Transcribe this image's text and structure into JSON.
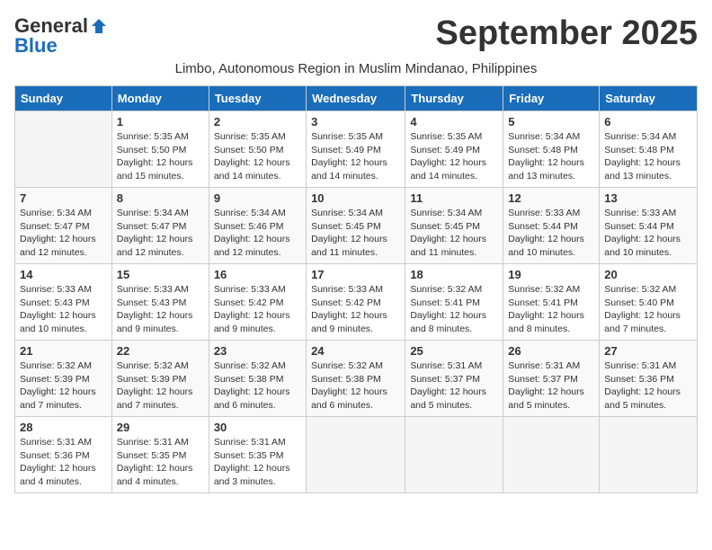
{
  "header": {
    "logo_general": "General",
    "logo_blue": "Blue",
    "month_title": "September 2025",
    "subtitle": "Limbo, Autonomous Region in Muslim Mindanao, Philippines"
  },
  "days_of_week": [
    "Sunday",
    "Monday",
    "Tuesday",
    "Wednesday",
    "Thursday",
    "Friday",
    "Saturday"
  ],
  "weeks": [
    [
      {
        "day": "",
        "info": ""
      },
      {
        "day": "1",
        "info": "Sunrise: 5:35 AM\nSunset: 5:50 PM\nDaylight: 12 hours\nand 15 minutes."
      },
      {
        "day": "2",
        "info": "Sunrise: 5:35 AM\nSunset: 5:50 PM\nDaylight: 12 hours\nand 14 minutes."
      },
      {
        "day": "3",
        "info": "Sunrise: 5:35 AM\nSunset: 5:49 PM\nDaylight: 12 hours\nand 14 minutes."
      },
      {
        "day": "4",
        "info": "Sunrise: 5:35 AM\nSunset: 5:49 PM\nDaylight: 12 hours\nand 14 minutes."
      },
      {
        "day": "5",
        "info": "Sunrise: 5:34 AM\nSunset: 5:48 PM\nDaylight: 12 hours\nand 13 minutes."
      },
      {
        "day": "6",
        "info": "Sunrise: 5:34 AM\nSunset: 5:48 PM\nDaylight: 12 hours\nand 13 minutes."
      }
    ],
    [
      {
        "day": "7",
        "info": "Sunrise: 5:34 AM\nSunset: 5:47 PM\nDaylight: 12 hours\nand 12 minutes."
      },
      {
        "day": "8",
        "info": "Sunrise: 5:34 AM\nSunset: 5:47 PM\nDaylight: 12 hours\nand 12 minutes."
      },
      {
        "day": "9",
        "info": "Sunrise: 5:34 AM\nSunset: 5:46 PM\nDaylight: 12 hours\nand 12 minutes."
      },
      {
        "day": "10",
        "info": "Sunrise: 5:34 AM\nSunset: 5:45 PM\nDaylight: 12 hours\nand 11 minutes."
      },
      {
        "day": "11",
        "info": "Sunrise: 5:34 AM\nSunset: 5:45 PM\nDaylight: 12 hours\nand 11 minutes."
      },
      {
        "day": "12",
        "info": "Sunrise: 5:33 AM\nSunset: 5:44 PM\nDaylight: 12 hours\nand 10 minutes."
      },
      {
        "day": "13",
        "info": "Sunrise: 5:33 AM\nSunset: 5:44 PM\nDaylight: 12 hours\nand 10 minutes."
      }
    ],
    [
      {
        "day": "14",
        "info": "Sunrise: 5:33 AM\nSunset: 5:43 PM\nDaylight: 12 hours\nand 10 minutes."
      },
      {
        "day": "15",
        "info": "Sunrise: 5:33 AM\nSunset: 5:43 PM\nDaylight: 12 hours\nand 9 minutes."
      },
      {
        "day": "16",
        "info": "Sunrise: 5:33 AM\nSunset: 5:42 PM\nDaylight: 12 hours\nand 9 minutes."
      },
      {
        "day": "17",
        "info": "Sunrise: 5:33 AM\nSunset: 5:42 PM\nDaylight: 12 hours\nand 9 minutes."
      },
      {
        "day": "18",
        "info": "Sunrise: 5:32 AM\nSunset: 5:41 PM\nDaylight: 12 hours\nand 8 minutes."
      },
      {
        "day": "19",
        "info": "Sunrise: 5:32 AM\nSunset: 5:41 PM\nDaylight: 12 hours\nand 8 minutes."
      },
      {
        "day": "20",
        "info": "Sunrise: 5:32 AM\nSunset: 5:40 PM\nDaylight: 12 hours\nand 7 minutes."
      }
    ],
    [
      {
        "day": "21",
        "info": "Sunrise: 5:32 AM\nSunset: 5:39 PM\nDaylight: 12 hours\nand 7 minutes."
      },
      {
        "day": "22",
        "info": "Sunrise: 5:32 AM\nSunset: 5:39 PM\nDaylight: 12 hours\nand 7 minutes."
      },
      {
        "day": "23",
        "info": "Sunrise: 5:32 AM\nSunset: 5:38 PM\nDaylight: 12 hours\nand 6 minutes."
      },
      {
        "day": "24",
        "info": "Sunrise: 5:32 AM\nSunset: 5:38 PM\nDaylight: 12 hours\nand 6 minutes."
      },
      {
        "day": "25",
        "info": "Sunrise: 5:31 AM\nSunset: 5:37 PM\nDaylight: 12 hours\nand 5 minutes."
      },
      {
        "day": "26",
        "info": "Sunrise: 5:31 AM\nSunset: 5:37 PM\nDaylight: 12 hours\nand 5 minutes."
      },
      {
        "day": "27",
        "info": "Sunrise: 5:31 AM\nSunset: 5:36 PM\nDaylight: 12 hours\nand 5 minutes."
      }
    ],
    [
      {
        "day": "28",
        "info": "Sunrise: 5:31 AM\nSunset: 5:36 PM\nDaylight: 12 hours\nand 4 minutes."
      },
      {
        "day": "29",
        "info": "Sunrise: 5:31 AM\nSunset: 5:35 PM\nDaylight: 12 hours\nand 4 minutes."
      },
      {
        "day": "30",
        "info": "Sunrise: 5:31 AM\nSunset: 5:35 PM\nDaylight: 12 hours\nand 3 minutes."
      },
      {
        "day": "",
        "info": ""
      },
      {
        "day": "",
        "info": ""
      },
      {
        "day": "",
        "info": ""
      },
      {
        "day": "",
        "info": ""
      }
    ]
  ]
}
